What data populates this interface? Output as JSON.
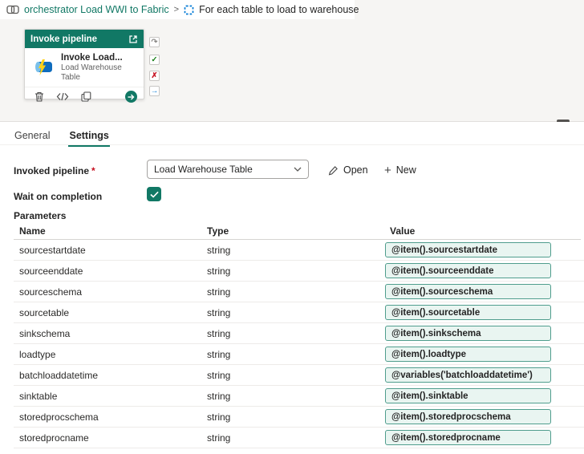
{
  "breadcrumb": {
    "parent": "orchestrator Load WWI to Fabric",
    "separator": ">",
    "current": "For each table to load to warehouse"
  },
  "activity": {
    "header": "Invoke pipeline",
    "title": "Invoke Load...",
    "subtitle": "Load Warehouse Table"
  },
  "connectors": [
    {
      "name": "skip-connector",
      "glyph": "↷",
      "color": "#8a8886"
    },
    {
      "name": "success-connector",
      "glyph": "✓",
      "color": "#107c10"
    },
    {
      "name": "fail-connector",
      "glyph": "✗",
      "color": "#c50f1f"
    },
    {
      "name": "completion-connector",
      "glyph": "→",
      "color": "#0078d4"
    }
  ],
  "panel": {
    "tabs": [
      {
        "label": "General"
      },
      {
        "label": "Settings"
      }
    ],
    "invoked_pipeline": {
      "label": "Invoked pipeline",
      "required_mark": "*",
      "value": "Load Warehouse Table",
      "open_label": "Open",
      "new_plus": "+",
      "new_label": "New"
    },
    "wait_on_completion": {
      "label": "Wait on completion",
      "checked": true
    },
    "parameters": {
      "heading": "Parameters",
      "columns": [
        "Name",
        "Type",
        "Value"
      ],
      "rows": [
        {
          "name": "sourcestartdate",
          "type": "string",
          "value": "@item().sourcestartdate"
        },
        {
          "name": "sourceenddate",
          "type": "string",
          "value": "@item().sourceenddate"
        },
        {
          "name": "sourceschema",
          "type": "string",
          "value": "@item().sourceschema"
        },
        {
          "name": "sourcetable",
          "type": "string",
          "value": "@item().sourcetable"
        },
        {
          "name": "sinkschema",
          "type": "string",
          "value": "@item().sinkschema"
        },
        {
          "name": "loadtype",
          "type": "string",
          "value": "@item().loadtype"
        },
        {
          "name": "batchloaddatetime",
          "type": "string",
          "value": "@variables('batchloaddatetime')"
        },
        {
          "name": "sinktable",
          "type": "string",
          "value": "@item().sinktable"
        },
        {
          "name": "storedprocschema",
          "type": "string",
          "value": "@item().storedprocschema"
        },
        {
          "name": "storedprocname",
          "type": "string",
          "value": "@item().storedprocname"
        }
      ]
    }
  },
  "colors": {
    "accent_teal": "#117865",
    "value_box_bg": "#e9f5f1",
    "value_box_border": "#4f9d8d",
    "foreach_blue": "#0078d4",
    "canvas_bg": "#f6f5f3"
  }
}
